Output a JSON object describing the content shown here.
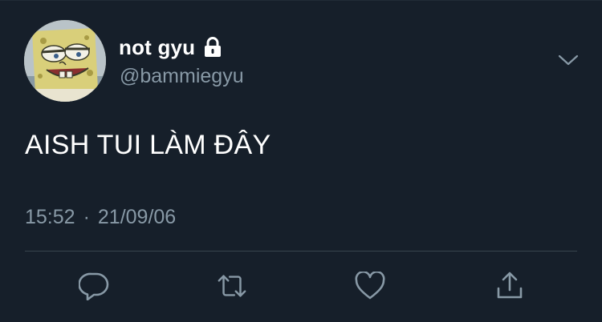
{
  "tweet": {
    "author": {
      "display_name": "not gyu",
      "handle": "@bammiegyu",
      "protected_icon": "lock-icon",
      "avatar_icon": "spongebob-avatar"
    },
    "text": "AISH TUI LÀM ĐÂY",
    "time": "15:52",
    "separator": "·",
    "date": "21/09/06"
  },
  "actions": {
    "reply_icon": "comment-bubble-icon",
    "retweet_icon": "retweet-icon",
    "like_icon": "heart-icon",
    "share_icon": "share-upload-icon",
    "more_icon": "chevron-down-icon"
  },
  "colors": {
    "background": "#15202b",
    "text_primary": "#ffffff",
    "text_secondary": "#8899a6",
    "divider": "#38444d"
  }
}
